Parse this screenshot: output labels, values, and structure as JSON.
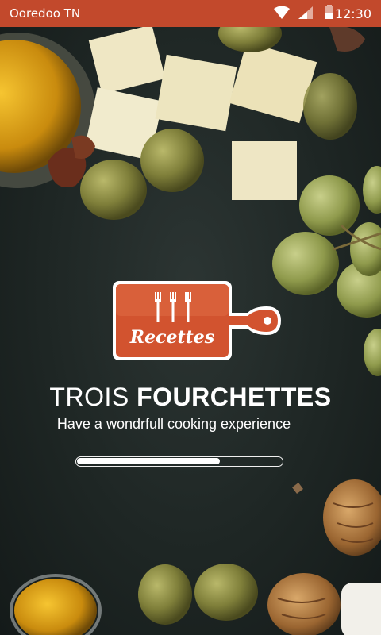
{
  "status_bar": {
    "carrier": "Ooredoo TN",
    "time": "12:30",
    "icons": [
      "wifi-icon",
      "cellular-signal-icon",
      "battery-icon"
    ],
    "background": "#c2492c"
  },
  "logo": {
    "label": "Recettes",
    "icon": "cutting-board-with-forks-icon",
    "color": "#d2532f"
  },
  "title": {
    "regular": "TROIS ",
    "bold": "FOURCHETTES"
  },
  "subtitle": "Have a wondrfull cooking experience",
  "progress": {
    "value": 0.7
  }
}
